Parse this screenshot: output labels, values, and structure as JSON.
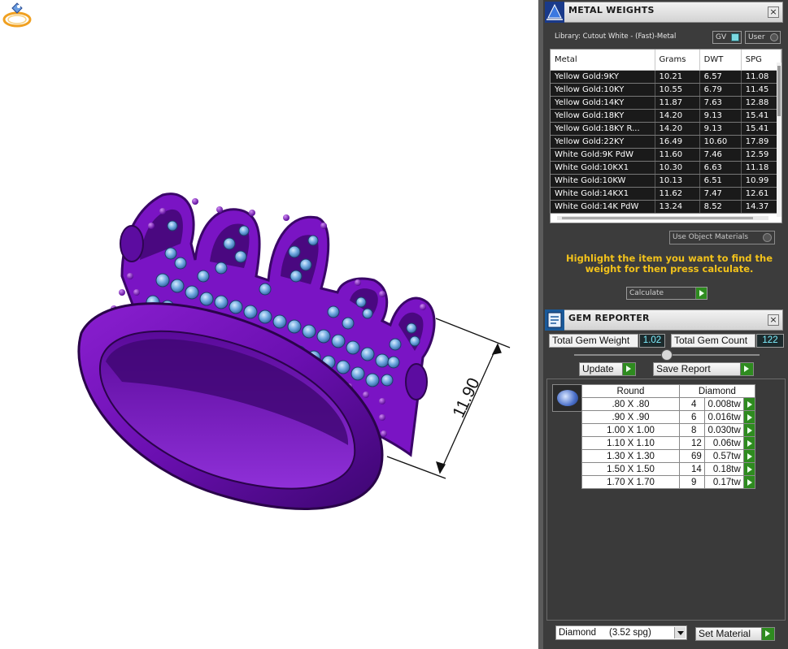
{
  "viewport": {
    "dimension_value": "11.90"
  },
  "metal_weights": {
    "title": "METAL WEIGHTS",
    "close_label": "×",
    "library_label": "Library: Cutout White - (Fast)-Metal",
    "gv_label": "GV",
    "user_label": "User",
    "columns": [
      "Metal",
      "Grams",
      "DWT",
      "SPG"
    ],
    "rows": [
      [
        "Yellow Gold:9KY",
        "10.21",
        "6.57",
        "11.08"
      ],
      [
        "Yellow Gold:10KY",
        "10.55",
        "6.79",
        "11.45"
      ],
      [
        "Yellow Gold:14KY",
        "11.87",
        "7.63",
        "12.88"
      ],
      [
        "Yellow Gold:18KY",
        "14.20",
        "9.13",
        "15.41"
      ],
      [
        "Yellow Gold:18KY R...",
        "14.20",
        "9.13",
        "15.41"
      ],
      [
        "Yellow Gold:22KY",
        "16.49",
        "10.60",
        "17.89"
      ],
      [
        "White Gold:9K PdW",
        "11.60",
        "7.46",
        "12.59"
      ],
      [
        "White Gold:10KX1",
        "10.30",
        "6.63",
        "11.18"
      ],
      [
        "White Gold:10KW",
        "10.13",
        "6.51",
        "10.99"
      ],
      [
        "White Gold:14KX1",
        "11.62",
        "7.47",
        "12.61"
      ],
      [
        "White Gold:14K PdW",
        "13.24",
        "8.52",
        "14.37"
      ]
    ],
    "use_object_materials": "Use Object Materials",
    "hint": "Highlight the item you want to find the weight for then press calculate.",
    "calculate_label": "Calculate"
  },
  "gem_reporter": {
    "title": "GEM REPORTER",
    "close_label": "×",
    "total_weight_label": "Total Gem Weight",
    "total_weight_value": "1.02",
    "total_count_label": "Total Gem Count",
    "total_count_value": "122",
    "update_label": "Update",
    "save_report_label": "Save Report",
    "table_header_shape": "Round",
    "table_header_material": "Diamond",
    "rows": [
      [
        ".80 X .80",
        "4",
        "0.008tw"
      ],
      [
        ".90 X .90",
        "6",
        "0.016tw"
      ],
      [
        "1.00 X 1.00",
        "8",
        "0.030tw"
      ],
      [
        "1.10 X 1.10",
        "12",
        "0.06tw"
      ],
      [
        "1.30 X 1.30",
        "69",
        "0.57tw"
      ],
      [
        "1.50 X 1.50",
        "14",
        "0.18tw"
      ],
      [
        "1.70 X 1.70",
        "9",
        "0.17tw"
      ]
    ],
    "material_select": "Diamond     (3.52 spg)",
    "set_material_label": "Set Material"
  }
}
